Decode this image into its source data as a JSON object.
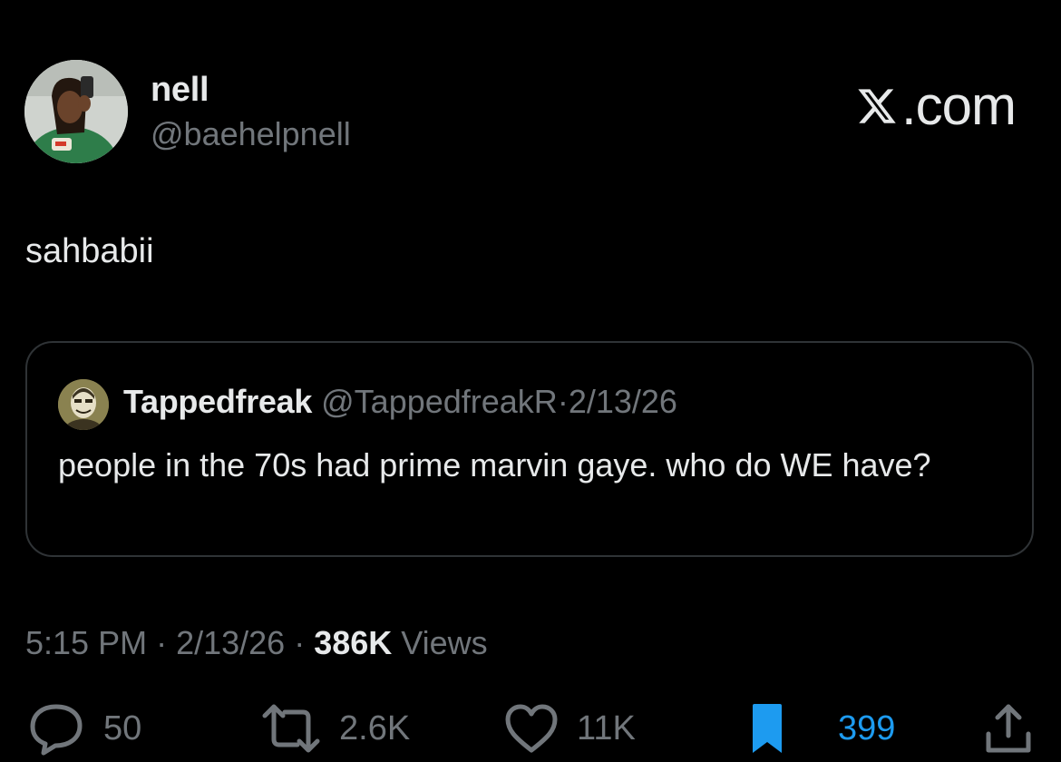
{
  "author": {
    "display_name": "nell",
    "handle": "@baehelpnell"
  },
  "brand": {
    "domain_suffix": ".com",
    "icon": "x-logo-icon"
  },
  "tweet": {
    "text": "sahbabii"
  },
  "quoted_tweet": {
    "display_name": "Tappedfreak",
    "handle": "@TappedfreakR",
    "separator": "·",
    "date": "2/13/26",
    "text": "people in the 70s had prime marvin gaye. who do WE have?"
  },
  "meta": {
    "time": "5:15 PM",
    "sep1": " · ",
    "date": "2/13/26",
    "sep2": " · ",
    "views_count": "386K",
    "views_label": " Views"
  },
  "actions": {
    "replies": {
      "icon": "reply-icon",
      "count": "50"
    },
    "reposts": {
      "icon": "repost-icon",
      "count": "2.6K"
    },
    "likes": {
      "icon": "heart-icon",
      "count": "11K"
    },
    "bookmarks": {
      "icon": "bookmark-icon",
      "count": "399",
      "active": true
    },
    "share": {
      "icon": "share-icon"
    }
  },
  "colors": {
    "background": "#000000",
    "primary_text": "#e7e9ea",
    "secondary_text": "#71767b",
    "border": "#2f3336",
    "accent_blue": "#1d9bf0"
  }
}
